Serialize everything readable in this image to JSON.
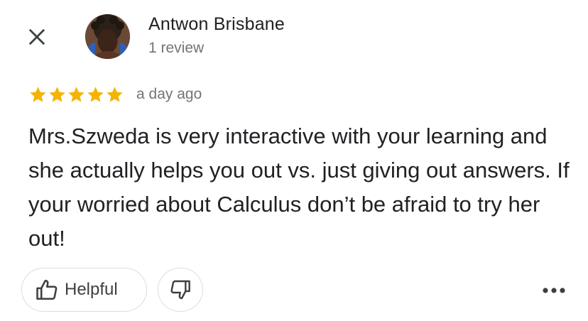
{
  "author": {
    "name": "Antwon Brisbane",
    "review_count": "1 review"
  },
  "review": {
    "rating": 5,
    "max_rating": 5,
    "time": "a day ago",
    "text": "Mrs.Szweda is very interactive with your learning and she actually helps you out vs. just giving out answers. If your worried about Calculus don’t be afraid to try her out!"
  },
  "actions": {
    "helpful_label": "Helpful"
  },
  "icons": {
    "close": "close-icon",
    "star": "star-icon",
    "thumbs_up": "thumbs-up-icon",
    "thumbs_down": "thumbs-down-icon",
    "more": "more-horizontal-icon"
  },
  "colors": {
    "star": "#f4b400",
    "text_primary": "#202124",
    "text_secondary": "#70757a",
    "outline": "#dadce0"
  }
}
